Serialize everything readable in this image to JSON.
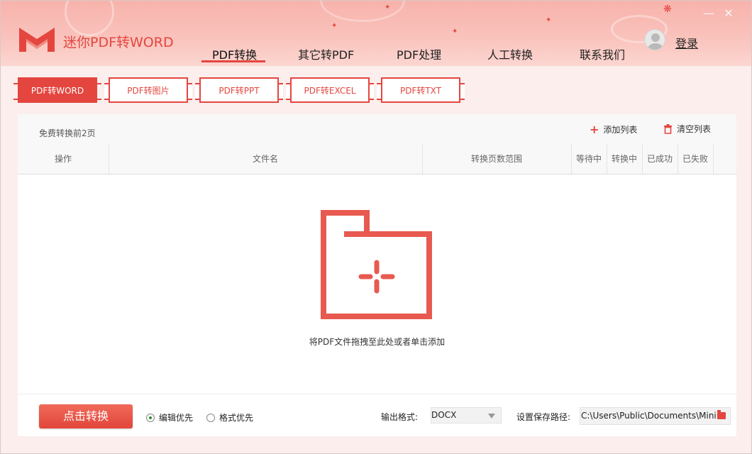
{
  "app": {
    "title": "迷你PDF转WORD"
  },
  "nav": {
    "items": [
      {
        "label": "PDF转换"
      },
      {
        "label": "其它转PDF"
      },
      {
        "label": "PDF处理"
      },
      {
        "label": "人工转换"
      },
      {
        "label": "联系我们"
      }
    ],
    "active": "PDF转换"
  },
  "user": {
    "login_label": "登录"
  },
  "window": {
    "minimize": "—",
    "close": "✕"
  },
  "subtabs": [
    {
      "label": "PDF转WORD"
    },
    {
      "label": "PDF转图片"
    },
    {
      "label": "PDF转PPT"
    },
    {
      "label": "PDF转EXCEL"
    },
    {
      "label": "PDF转TXT"
    }
  ],
  "panel": {
    "free_note": "免费转换前2页",
    "add_list": "添加列表",
    "clear_list": "清空列表",
    "columns": [
      "操作",
      "文件名",
      "转换页数范围",
      "等待中",
      "转换中",
      "已成功",
      "已失败"
    ],
    "drop_text": "将PDF文件拖拽至此处或者单击添加"
  },
  "bottom": {
    "convert_label": "点击转换",
    "radio_edit": "编辑优先",
    "radio_format": "格式优先",
    "radio_selected": "编辑优先",
    "output_format_label": "输出格式:",
    "output_format_value": "DOCX",
    "save_path_label": "设置保存路径:",
    "save_path_value": "C:\\Users\\Public\\Documents\\Mini"
  },
  "colors": {
    "accent": "#e4463f",
    "header_bg": "#f9c2bb"
  },
  "icons": {
    "add": "plus-icon",
    "clear": "trash-icon",
    "folder": "folder-icon",
    "drop": "folder-add-icon"
  }
}
